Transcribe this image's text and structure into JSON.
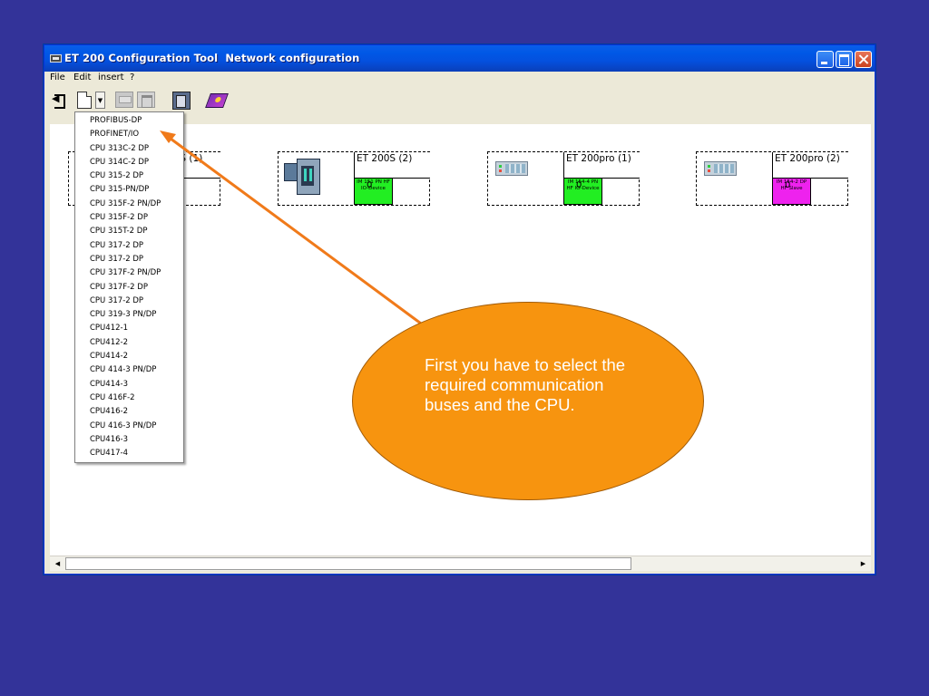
{
  "window": {
    "title": "ET 200 Configuration Tool  Network configuration",
    "controls": {
      "minimize": "",
      "maximize": "",
      "close": ""
    }
  },
  "menu": [
    "File",
    "Edit",
    "insert",
    "?"
  ],
  "toolbar": {
    "icons": [
      "exit-icon",
      "new-document-icon",
      "dropdown-arrow-icon",
      "station-icon",
      "network-icon",
      "configure-icon",
      "help-book-icon"
    ]
  },
  "device_list": [
    "PROFIBUS-DP",
    "PROFINET/IO",
    "CPU 313C-2 DP",
    "CPU 314C-2 DP",
    "CPU 315-2 DP",
    "CPU 315-PN/DP",
    "CPU 315F-2 PN/DP",
    "CPU 315F-2 DP",
    "CPU 315T-2 DP",
    "CPU 317-2 DP",
    "CPU 317-2 DP",
    "CPU 317F-2 PN/DP",
    "CPU 317F-2 DP",
    "CPU 317-2 DP",
    "CPU 319-3 PN/DP",
    "CPU412-1",
    "CPU412-2",
    "CPU414-2",
    "CPU 414-3 PN/DP",
    "CPU414-3",
    "CPU 416F-2",
    "CPU416-2",
    "CPU 416-3 PN/DP",
    "CPU416-3",
    "CPU417-4"
  ],
  "stations": [
    {
      "title": "ET 200S (1)",
      "module": "",
      "count": "",
      "color": "#ffffff",
      "image": "et200s"
    },
    {
      "title": "ET 200S (2)",
      "module": "IM 151 PN HF IO-Device",
      "count": "0",
      "color": "#22ee22",
      "image": "et200s"
    },
    {
      "title": "ET 200pro (1)",
      "module": "IM 154-4 PN HF IO-Device",
      "count": "0",
      "color": "#22ee22",
      "image": "et200pro"
    },
    {
      "title": "ET 200pro (2)",
      "module": "IM 154-2 DP HF Slave",
      "count": "0",
      "color": "#ee22ee",
      "image": "et200pro"
    }
  ],
  "annotation": {
    "text": "First you have to select the required communication buses and the CPU.",
    "color": "#f7940f",
    "arrow_color": "#f07a1a"
  },
  "colors": {
    "background": "#333399",
    "titlebar": "#0058e6",
    "io_device": "#22ee22",
    "dp_slave": "#ee22ee"
  }
}
